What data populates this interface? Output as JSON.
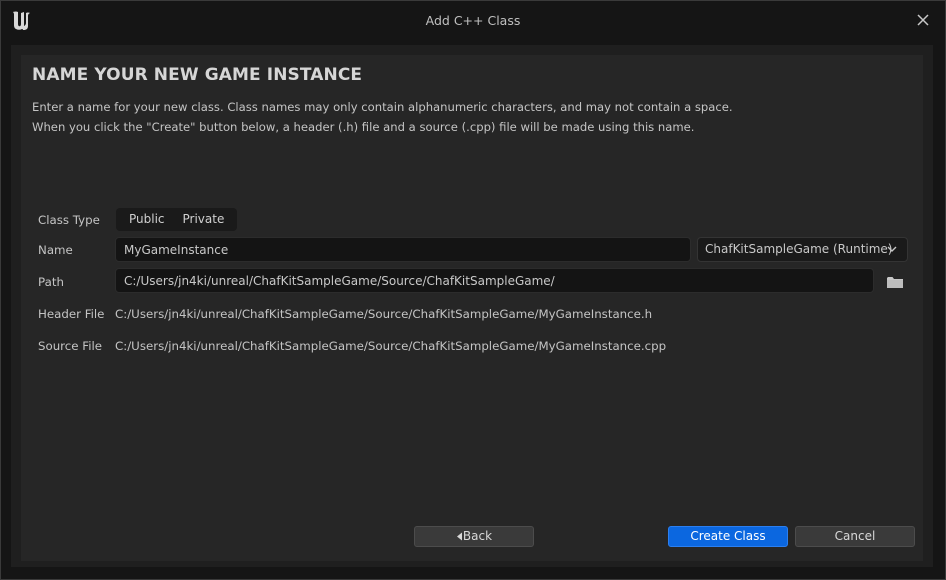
{
  "window": {
    "title": "Add C++ Class",
    "logo_icon": "unreal-engine-logo",
    "close_icon": "close-icon"
  },
  "page": {
    "heading": "NAME YOUR NEW GAME INSTANCE",
    "description_line1": "Enter a name for your new class. Class names may only contain alphanumeric characters, and may not contain a space.",
    "description_line2": "When you click the \"Create\" button below, a header (.h) file and a source (.cpp) file will be made using this name."
  },
  "form": {
    "class_type": {
      "label": "Class Type",
      "options": [
        "Public",
        "Private"
      ]
    },
    "name": {
      "label": "Name",
      "value": "MyGameInstance"
    },
    "module": {
      "selected": "ChafKitSampleGame (Runtime)",
      "icon": "chevron-down-icon"
    },
    "path": {
      "label": "Path",
      "value": "C:/Users/jn4ki/unreal/ChafKitSampleGame/Source/ChafKitSampleGame/",
      "browse_icon": "folder-icon"
    },
    "header_file": {
      "label": "Header File",
      "value": "C:/Users/jn4ki/unreal/ChafKitSampleGame/Source/ChafKitSampleGame/MyGameInstance.h"
    },
    "source_file": {
      "label": "Source File",
      "value": "C:/Users/jn4ki/unreal/ChafKitSampleGame/Source/ChafKitSampleGame/MyGameInstance.cpp"
    }
  },
  "buttons": {
    "back": "Back",
    "create": "Create Class",
    "cancel": "Cancel"
  },
  "colors": {
    "accent": "#0b67e0",
    "background": "#151515",
    "panel": "#262626"
  }
}
